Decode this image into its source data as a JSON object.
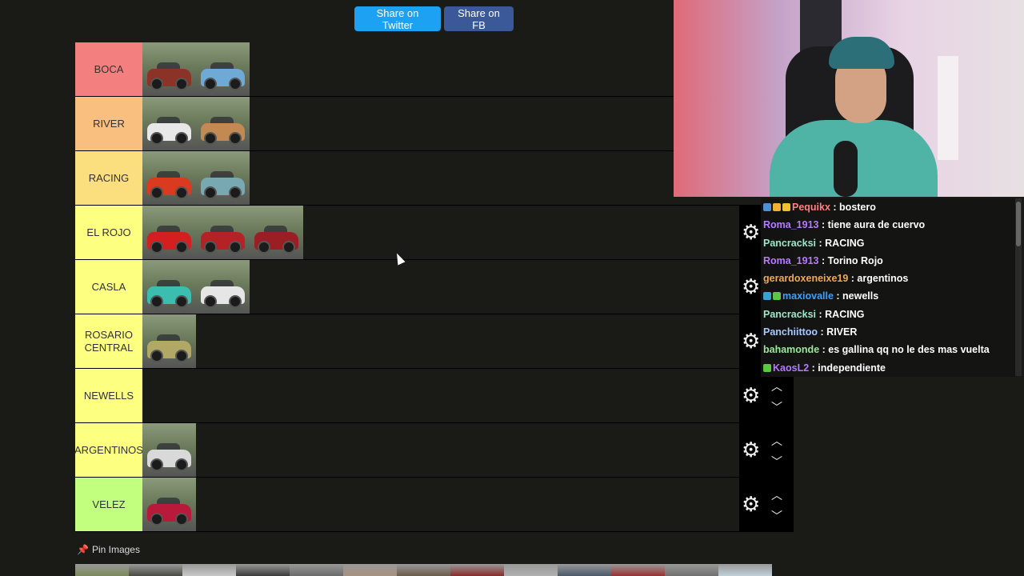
{
  "share": {
    "twitter_label": "Share on Twitter",
    "fb_label": "Share on FB"
  },
  "colors": {
    "tier_red": "#f47f7f",
    "tier_orange": "#f9bf7e",
    "tier_yellow_light": "#fbdf7f",
    "tier_yellow": "#fcff7f",
    "tier_green": "#c2ff7f"
  },
  "tiers": [
    {
      "label": "BOCA",
      "color": "#f47f7f",
      "items": [
        "#8a3326",
        "#6fa9d6"
      ]
    },
    {
      "label": "RIVER",
      "color": "#f9bf7e",
      "items": [
        "#e8e8e8",
        "#c28a52"
      ]
    },
    {
      "label": "RACING",
      "color": "#fbdf7f",
      "items": [
        "#d93a20",
        "#78a9b2"
      ]
    },
    {
      "label": "EL ROJO",
      "color": "#fcff7f",
      "items": [
        "#d31f1f",
        "#b52225",
        "#9a1f24"
      ]
    },
    {
      "label": "CASLA",
      "color": "#fcff7f",
      "items": [
        "#3bbdb0",
        "#e6e6e6"
      ]
    },
    {
      "label": "ROSARIO CENTRAL",
      "color": "#fcff7f",
      "items": [
        "#b1a866"
      ]
    },
    {
      "label": "NEWELLS",
      "color": "#fcff7f",
      "items": []
    },
    {
      "label": "ARGENTINOS",
      "color": "#fcff7f",
      "items": [
        "#d9d9d9"
      ]
    },
    {
      "label": "VELEZ",
      "color": "#c2ff7f",
      "items": [
        "#b91a3a"
      ]
    }
  ],
  "tier_controls": {
    "gear_icon": "gear-icon",
    "up_icon": "chevron-up-icon",
    "down_icon": "chevron-down-icon"
  },
  "chat": [
    {
      "user": "Pequikx",
      "color": "#ff7f7f",
      "text": " : bostero",
      "badges": [
        "#4f8fd3",
        "#f0b030",
        "#f0c030"
      ]
    },
    {
      "user": "Roma_1913",
      "color": "#b57bff",
      "text": " : tiene aura de cuervo",
      "badges": []
    },
    {
      "user": "Pancracksi",
      "color": "#9be7c8",
      "text": " : RACING",
      "badges": []
    },
    {
      "user": "Roma_1913",
      "color": "#b57bff",
      "text": " : Torino Rojo",
      "badges": []
    },
    {
      "user": "gerardoxeneixe19",
      "color": "#f0a955",
      "text": " : argentinos",
      "badges": []
    },
    {
      "user": "maxiovalle",
      "color": "#3aa0ff",
      "text": " : newells",
      "badges": [
        "#3aa0d0",
        "#5ac840"
      ]
    },
    {
      "user": "Pancracksi",
      "color": "#9be7c8",
      "text": " : RACING",
      "badges": []
    },
    {
      "user": "Panchiittoo",
      "color": "#a8c8ff",
      "text": " : RIVER",
      "badges": []
    },
    {
      "user": "bahamonde",
      "color": "#9be79b",
      "text": " : es gallina qq no le des mas vuelta",
      "badges": []
    },
    {
      "user": "KaosL2",
      "color": "#b57bff",
      "text": " : independiente",
      "badges": [
        "#5ac840"
      ]
    }
  ],
  "pin": {
    "label": "Pin Images"
  },
  "pool_colors": [
    "#7a8a5a",
    "#4a4a44",
    "#c8c8c8",
    "#3a3a3a",
    "#6a6a6a",
    "#a89080",
    "#6b5b4b",
    "#8a2a2a",
    "#b0b0b0",
    "#4a5a6a",
    "#9a3030",
    "#707070",
    "#c0d0d8"
  ]
}
